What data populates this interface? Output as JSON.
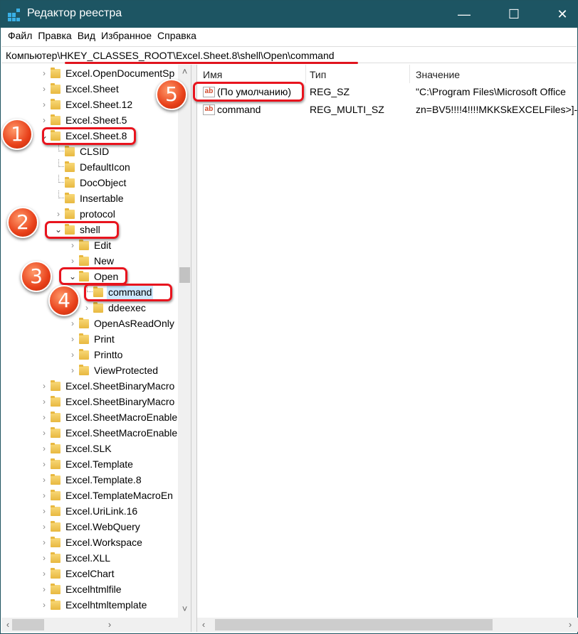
{
  "window": {
    "title": "Редактор реестра",
    "minimize": "—",
    "maximize": "☐",
    "close": "✕"
  },
  "menu": [
    "Файл",
    "Правка",
    "Вид",
    "Избранное",
    "Справка"
  ],
  "address": "Компьютер\\HKEY_CLASSES_ROOT\\Excel.Sheet.8\\shell\\Open\\command",
  "tree": [
    {
      "label": "Excel.OpenDocumentSp",
      "level": 0,
      "state": "collapsed"
    },
    {
      "label": "Excel.Sheet",
      "level": 0,
      "state": "collapsed"
    },
    {
      "label": "Excel.Sheet.12",
      "level": 0,
      "state": "collapsed"
    },
    {
      "label": "Excel.Sheet.5",
      "level": 0,
      "state": "collapsed"
    },
    {
      "label": "Excel.Sheet.8",
      "level": 0,
      "state": "expanded"
    },
    {
      "label": "CLSID",
      "level": 1,
      "state": "leaf"
    },
    {
      "label": "DefaultIcon",
      "level": 1,
      "state": "leaf"
    },
    {
      "label": "DocObject",
      "level": 1,
      "state": "leaf"
    },
    {
      "label": "Insertable",
      "level": 1,
      "state": "leaf"
    },
    {
      "label": "protocol",
      "level": 1,
      "state": "collapsed"
    },
    {
      "label": "shell",
      "level": 1,
      "state": "expanded"
    },
    {
      "label": "Edit",
      "level": 2,
      "state": "collapsed"
    },
    {
      "label": "New",
      "level": 2,
      "state": "collapsed"
    },
    {
      "label": "Open",
      "level": 2,
      "state": "expanded"
    },
    {
      "label": "command",
      "level": 3,
      "state": "leaf",
      "selected": true
    },
    {
      "label": "ddeexec",
      "level": 3,
      "state": "collapsed"
    },
    {
      "label": "OpenAsReadOnly",
      "level": 2,
      "state": "collapsed"
    },
    {
      "label": "Print",
      "level": 2,
      "state": "collapsed"
    },
    {
      "label": "Printto",
      "level": 2,
      "state": "collapsed"
    },
    {
      "label": "ViewProtected",
      "level": 2,
      "state": "collapsed"
    },
    {
      "label": "Excel.SheetBinaryMacro",
      "level": 0,
      "state": "collapsed"
    },
    {
      "label": "Excel.SheetBinaryMacro",
      "level": 0,
      "state": "collapsed"
    },
    {
      "label": "Excel.SheetMacroEnable",
      "level": 0,
      "state": "collapsed"
    },
    {
      "label": "Excel.SheetMacroEnable",
      "level": 0,
      "state": "collapsed"
    },
    {
      "label": "Excel.SLK",
      "level": 0,
      "state": "collapsed"
    },
    {
      "label": "Excel.Template",
      "level": 0,
      "state": "collapsed"
    },
    {
      "label": "Excel.Template.8",
      "level": 0,
      "state": "collapsed"
    },
    {
      "label": "Excel.TemplateMacroEn",
      "level": 0,
      "state": "collapsed"
    },
    {
      "label": "Excel.UriLink.16",
      "level": 0,
      "state": "collapsed"
    },
    {
      "label": "Excel.WebQuery",
      "level": 0,
      "state": "collapsed"
    },
    {
      "label": "Excel.Workspace",
      "level": 0,
      "state": "collapsed"
    },
    {
      "label": "Excel.XLL",
      "level": 0,
      "state": "collapsed"
    },
    {
      "label": "ExcelChart",
      "level": 0,
      "state": "collapsed"
    },
    {
      "label": "Excelhtmlfile",
      "level": 0,
      "state": "collapsed"
    },
    {
      "label": "Excelhtmltemplate",
      "level": 0,
      "state": "collapsed"
    }
  ],
  "columns": {
    "name": "Имя",
    "type": "Тип",
    "value": "Значение"
  },
  "values": [
    {
      "name": "(По умолчанию)",
      "type": "REG_SZ",
      "data": "\"C:\\Program Files\\Microsoft Office"
    },
    {
      "name": "command",
      "type": "REG_MULTI_SZ",
      "data": "zn=BV5!!!!4!!!!MKKSkEXCELFiles>]-"
    }
  ],
  "annotations": [
    "1",
    "2",
    "3",
    "4",
    "5"
  ],
  "accent": "#e8141e"
}
